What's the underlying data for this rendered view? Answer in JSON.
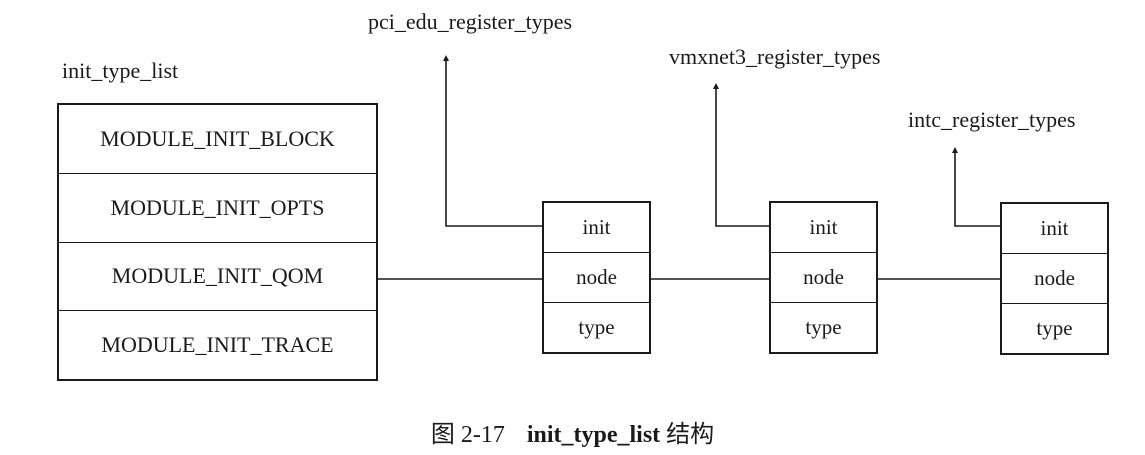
{
  "list": {
    "title": "init_type_list",
    "rows": [
      "MODULE_INIT_BLOCK",
      "MODULE_INIT_OPTS",
      "MODULE_INIT_QOM",
      "MODULE_INIT_TRACE"
    ]
  },
  "nodes": [
    {
      "target": "pci_edu_register_types",
      "fields": [
        "init",
        "node",
        "type"
      ]
    },
    {
      "target": "vmxnet3_register_types",
      "fields": [
        "init",
        "node",
        "type"
      ]
    },
    {
      "target": "intc_register_types",
      "fields": [
        "init",
        "node",
        "type"
      ]
    }
  ],
  "caption": {
    "number": "图 2-17",
    "name": "init_type_list",
    "suffix": " 结构"
  }
}
